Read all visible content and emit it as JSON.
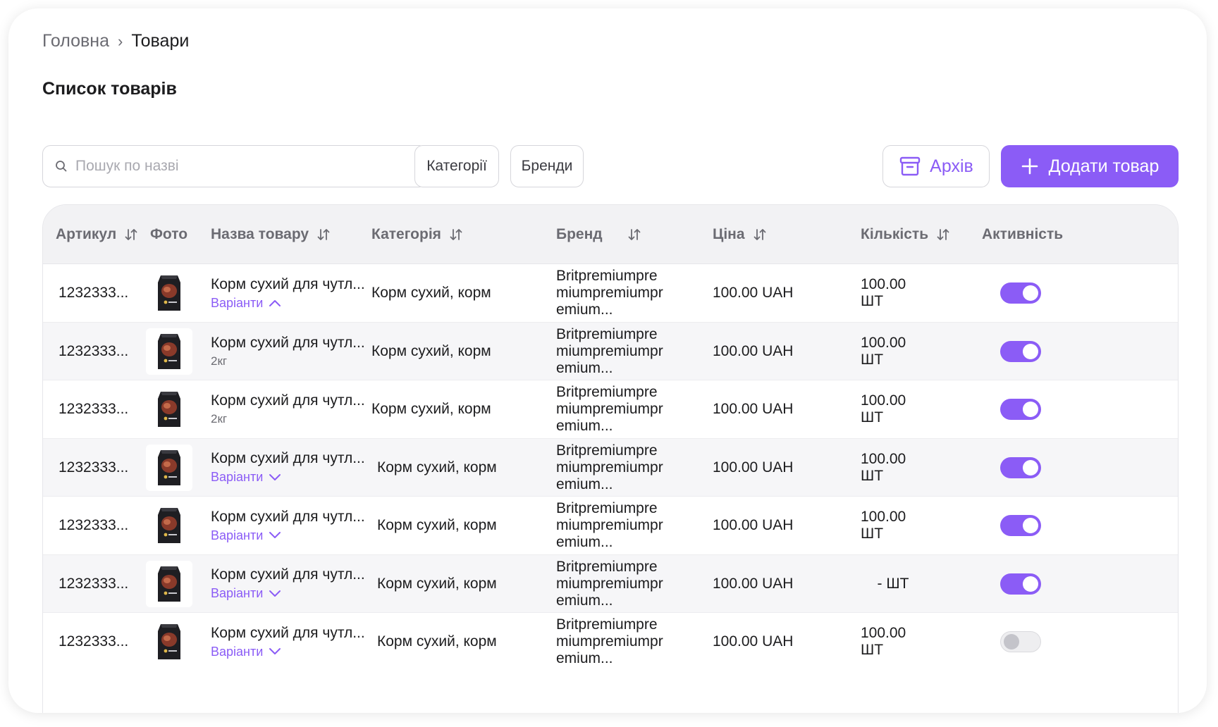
{
  "breadcrumb": {
    "home": "Головна",
    "separator": "›",
    "current": "Товари"
  },
  "page_title": "Список товарів",
  "toolbar": {
    "search_placeholder": "Пошук по назві",
    "search_value": "",
    "categories_label": "Категорії",
    "brands_label": "Бренди",
    "archive_label": "Архів",
    "add_label": "Додати товар"
  },
  "colors": {
    "accent": "#8b5cf6",
    "header_bg": "#f2f2f4",
    "text": "#1c1c1e",
    "muted": "#6b6b72"
  },
  "table": {
    "columns": [
      "Артикул",
      "Фото",
      "Назва товару",
      "Категорія",
      "Бренд",
      "Ціна",
      "Кількість",
      "Активність"
    ],
    "rows": [
      {
        "sku": "1232333...",
        "name": "Корм сухий для чутл...",
        "sub": "",
        "variants": "Варіанти",
        "variants_state": "expanded",
        "category": "Корм сухий, корм",
        "brand": "Britpremiumpre miumpremiumpr emium...",
        "price": "100.00 UAH",
        "qty": "100.00 ШТ",
        "active": true
      },
      {
        "sku": "1232333...",
        "name": "Корм сухий для чутл...",
        "sub": "2кг",
        "variants": "",
        "variants_state": "none",
        "category": "Корм сухий, корм",
        "brand": "Britpremiumpre miumpremiumpr emium...",
        "price": "100.00 UAH",
        "qty": "100.00 ШТ",
        "active": true
      },
      {
        "sku": "1232333...",
        "name": "Корм сухий для чутл...",
        "sub": "2кг",
        "variants": "",
        "variants_state": "none",
        "category": "Корм сухий, корм",
        "brand": "Britpremiumpre miumpremiumpr emium...",
        "price": "100.00 UAH",
        "qty": "100.00 ШТ",
        "active": true
      },
      {
        "sku": "1232333...",
        "name": "Корм сухий для чутл...",
        "sub": "",
        "variants": "Варіанти",
        "variants_state": "collapsed",
        "category": "Корм сухий, корм",
        "brand": "Britpremiumpre miumpremiumpr emium...",
        "price": "100.00 UAH",
        "qty": "100.00 ШТ",
        "active": true
      },
      {
        "sku": "1232333...",
        "name": "Корм сухий для чутл...",
        "sub": "",
        "variants": "Варіанти",
        "variants_state": "collapsed",
        "category": "Корм сухий, корм",
        "brand": "Britpremiumpre miumpremiumpr emium...",
        "price": "100.00 UAH",
        "qty": "100.00 ШТ",
        "active": true
      },
      {
        "sku": "1232333...",
        "name": "Корм сухий для чутл...",
        "sub": "",
        "variants": "Варіанти",
        "variants_state": "collapsed",
        "category": "Корм сухий, корм",
        "brand": "Britpremiumpre miumpremiumpr emium...",
        "price": "100.00 UAH",
        "qty": "- ШТ",
        "active": true
      },
      {
        "sku": "1232333...",
        "name": "Корм сухий для чутл...",
        "sub": "",
        "variants": "Варіанти",
        "variants_state": "collapsed",
        "category": "Корм сухий, корм",
        "brand": "Britpremiumpre miumpremiumpr emium...",
        "price": "100.00 UAH",
        "qty": "100.00 ШТ",
        "active": false
      }
    ]
  }
}
